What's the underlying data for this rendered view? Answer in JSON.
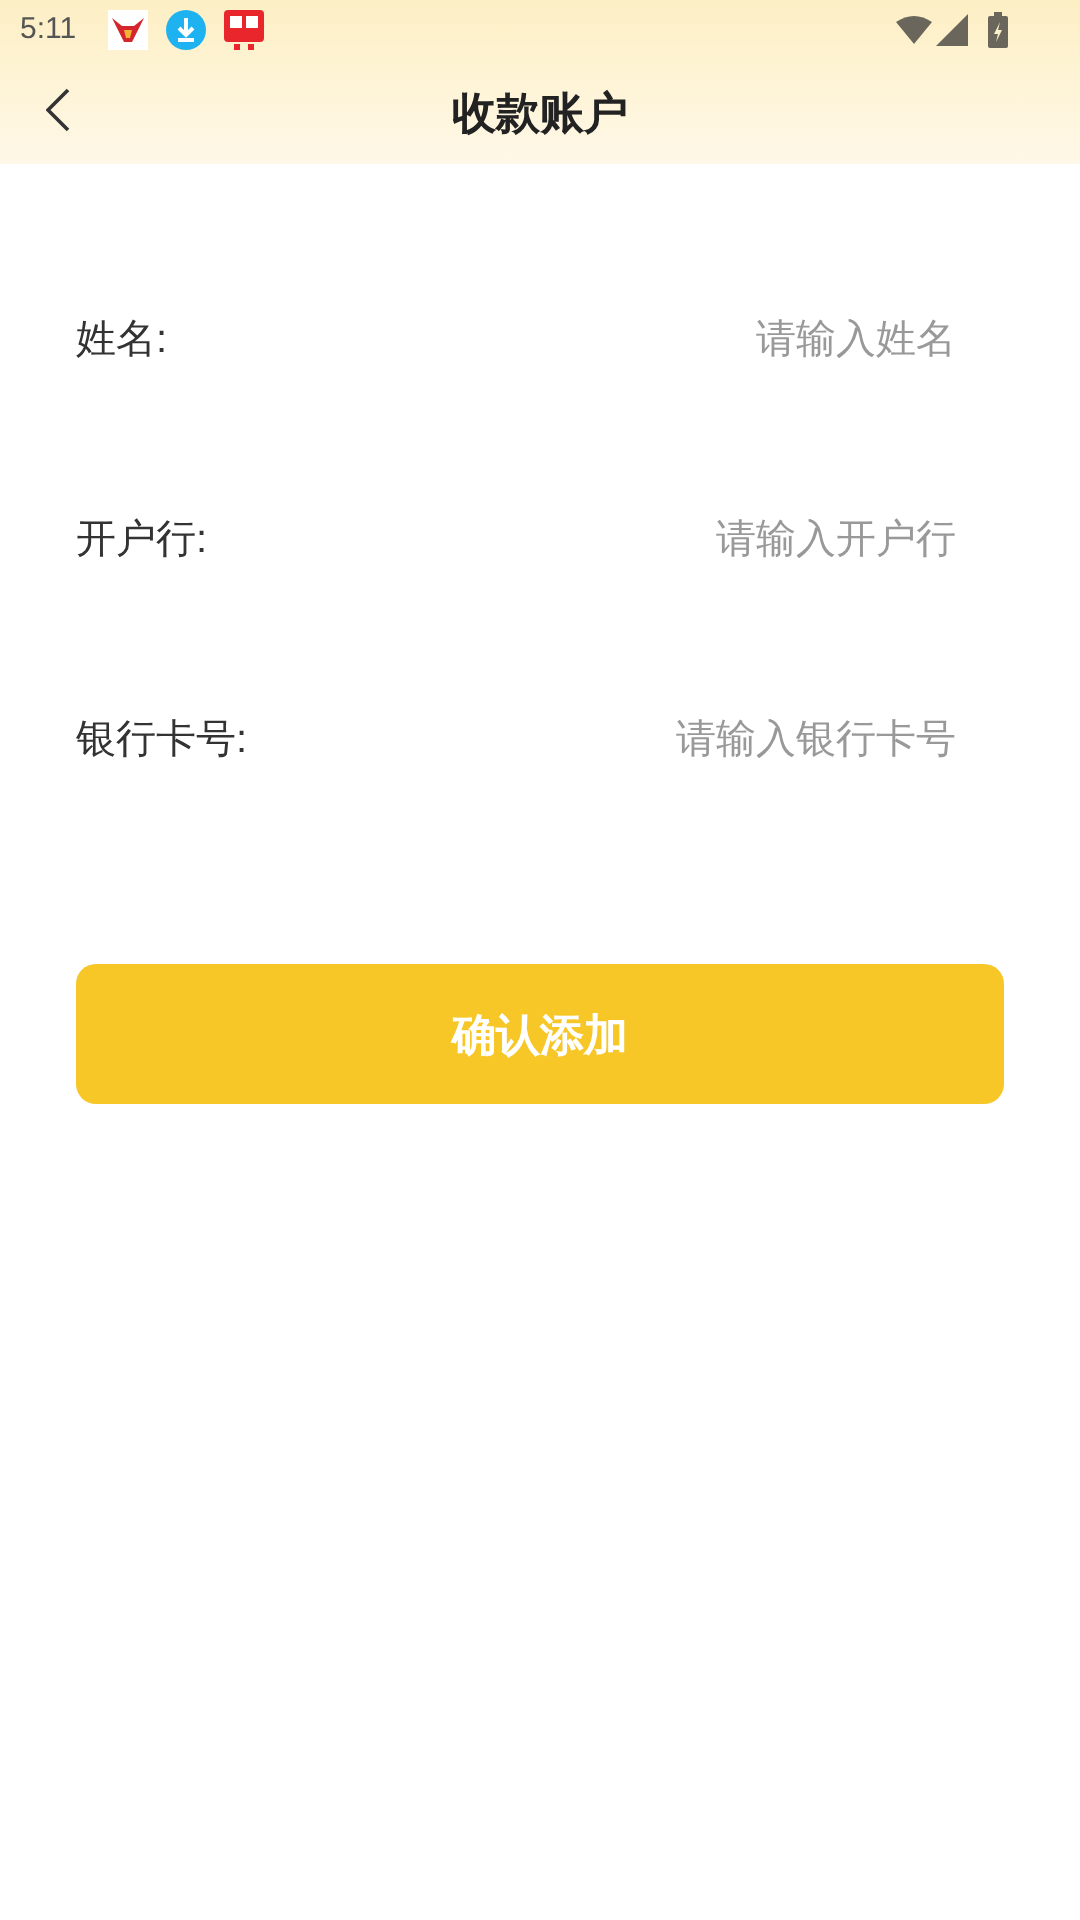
{
  "status_bar": {
    "time": "5:11"
  },
  "header": {
    "title": "收款账户"
  },
  "form": {
    "fields": [
      {
        "label": "姓名:",
        "placeholder": "请输入姓名"
      },
      {
        "label": "开户行:",
        "placeholder": "请输入开户行"
      },
      {
        "label": "银行卡号:",
        "placeholder": "请输入银行卡号"
      }
    ]
  },
  "submit_button": {
    "label": "确认添加"
  }
}
